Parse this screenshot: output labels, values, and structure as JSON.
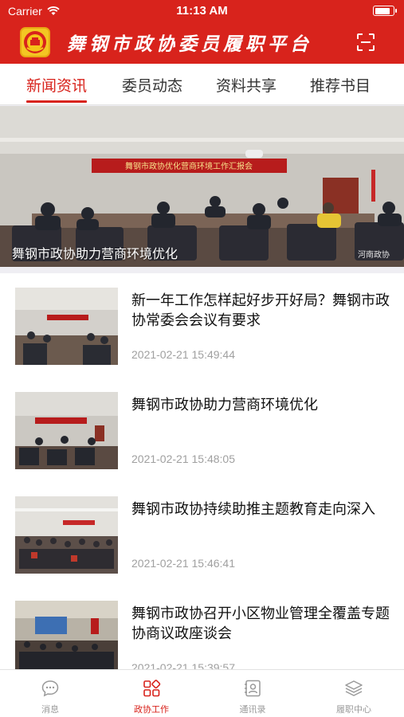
{
  "status_bar": {
    "carrier": "Carrier",
    "time": "11:13 AM",
    "battery_level": 0.9
  },
  "header": {
    "title": "舞钢市政协委员履职平台",
    "logo_icon": "cppcc-emblem-icon",
    "scan_icon": "scan-icon"
  },
  "colors": {
    "brand": "#d8231c"
  },
  "tabs": [
    {
      "label": "新闻资讯",
      "active": true
    },
    {
      "label": "委员动态",
      "active": false
    },
    {
      "label": "资料共享",
      "active": false
    },
    {
      "label": "推荐书目",
      "active": false
    }
  ],
  "banner": {
    "caption": "舞钢市政协助力营商环境优化",
    "backdrop_text": "舞钢市政协优化营商环境工作汇报会",
    "watermark": "河南政协"
  },
  "news": [
    {
      "title": "新一年工作怎样起好步开好局？舞钢市政协常委会会议有要求",
      "date": "2021-02-21 15:49:44"
    },
    {
      "title": "舞钢市政协助力营商环境优化",
      "date": "2021-02-21 15:48:05"
    },
    {
      "title": "舞钢市政协持续助推主题教育走向深入",
      "date": "2021-02-21 15:46:41"
    },
    {
      "title": "舞钢市政协召开小区物业管理全覆盖专题协商议政座谈会",
      "date": "2021-02-21 15:39:57"
    }
  ],
  "tabbar": [
    {
      "label": "消息",
      "icon": "message-icon",
      "active": false
    },
    {
      "label": "政协工作",
      "icon": "grid-icon",
      "active": true
    },
    {
      "label": "通讯录",
      "icon": "contacts-icon",
      "active": false
    },
    {
      "label": "履职中心",
      "icon": "layers-icon",
      "active": false
    }
  ]
}
